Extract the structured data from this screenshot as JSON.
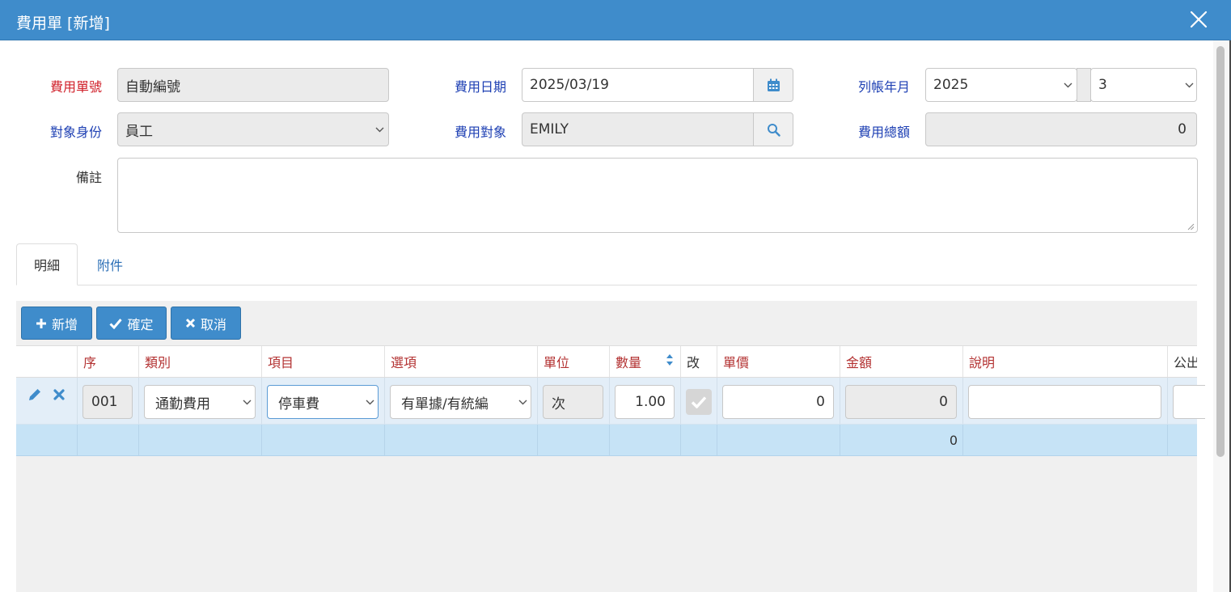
{
  "dialog": {
    "title": "費用單 [新增]"
  },
  "form": {
    "doc_no": {
      "label": "費用單號",
      "value": "自動編號"
    },
    "date": {
      "label": "費用日期",
      "value": "2025/03/19"
    },
    "period": {
      "label": "列帳年月",
      "year": "2025",
      "month": "3"
    },
    "target_type": {
      "label": "對象身份",
      "value": "員工"
    },
    "target": {
      "label": "費用對象",
      "value": "EMILY"
    },
    "total": {
      "label": "費用總額",
      "value": "0"
    },
    "note": {
      "label": "備註",
      "value": ""
    }
  },
  "tabs": [
    {
      "label": "明細"
    },
    {
      "label": "附件"
    }
  ],
  "toolbar": {
    "add_label": "新增",
    "confirm_label": "確定",
    "cancel_label": "取消"
  },
  "table": {
    "columns": [
      "序",
      "類別",
      "項目",
      "選項",
      "單位",
      "數量",
      "改",
      "單價",
      "金額",
      "說明",
      "公出"
    ],
    "rows": [
      {
        "seq": "001",
        "category": "通勤費用",
        "item": "停車費",
        "option": "有單據/有統編",
        "unit": "次",
        "qty": "1.00",
        "modified": true,
        "price": "0",
        "amount": "0",
        "desc": ""
      }
    ],
    "totals": {
      "amount": "0"
    }
  },
  "colors": {
    "titlebar": "#3f8ccb",
    "button": "#3f8ccb",
    "label_required": "#d0202a",
    "label_field": "#1d3fb3",
    "header_text": "#b33232"
  }
}
